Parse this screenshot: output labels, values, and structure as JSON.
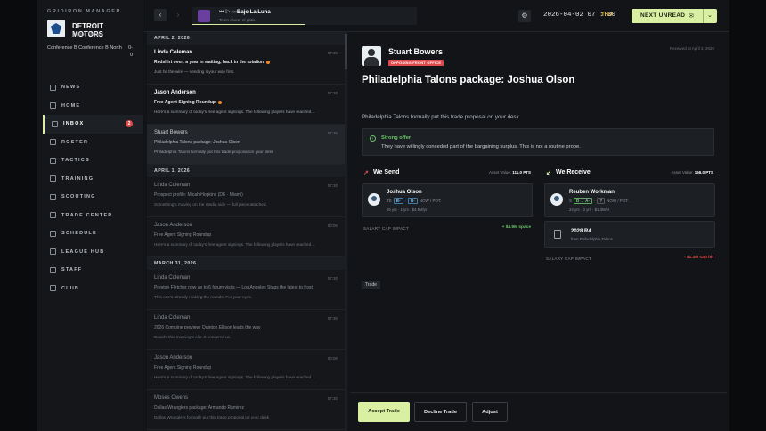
{
  "sidebar": {
    "brand": "GRIDIRON MANAGER",
    "team_name": "DETROIT MOTORS",
    "team_sub": "Detroit Motors",
    "conference": "Conference B Conference B North",
    "record_a": "0-",
    "record_b": "0",
    "items": [
      {
        "label": "NEWS"
      },
      {
        "label": "HOME"
      },
      {
        "label": "INBOX",
        "badge": "2"
      },
      {
        "label": "ROSTER"
      },
      {
        "label": "TACTICS"
      },
      {
        "label": "TRAINING"
      },
      {
        "label": "SCOUTING"
      },
      {
        "label": "TRADE CENTER"
      },
      {
        "label": "SCHEDULE"
      },
      {
        "label": "LEAGUE HUB"
      },
      {
        "label": "STAFF"
      },
      {
        "label": "CLUB"
      }
    ]
  },
  "topbar": {
    "back": "‹",
    "forward": "›",
    "song": "Bajo La Luna",
    "artist": "Te en crucer el patio",
    "controls": "⏮ ▷ ⏭",
    "gear": "⚙",
    "datetime": "2026-04-02 07 : 30",
    "day": "THU",
    "next_unread": "NEXT UNREAD",
    "mail_icon": "✉",
    "chevron": "⌄"
  },
  "inbox": {
    "days": [
      {
        "label": "APRIL 2, 2026",
        "messages": [
          {
            "from": "Linda Coleman",
            "time": "07:30",
            "subject": "Redshirt over: a year in waiting, back in the rotation",
            "preview": "Just hit the wire — sending it your way first.",
            "unread": true
          },
          {
            "from": "Jason Anderson",
            "time": "07:30",
            "subject": "Free Agent Signing Roundup",
            "preview": "Here's a summary of today's free agent signings. The following players have reached...",
            "unread": true
          },
          {
            "from": "Stuart Bowers",
            "time": "07:30",
            "subject": "Philadelphia Talons package: Joshua Olson",
            "preview": "Philadelphia Talons formally put this trade proposal on your desk",
            "selected": true
          }
        ]
      },
      {
        "label": "APRIL 1, 2026",
        "messages": [
          {
            "from": "Linda Coleman",
            "time": "07:30",
            "subject": "Prospect profile: Micah Hopkins (DE · Miami)",
            "preview": "Something's moving on the media side — full piece attached."
          },
          {
            "from": "Jason Anderson",
            "time": "00:00",
            "subject": "Free Agent Signing Roundup",
            "preview": "Here's a summary of today's free agent signings. The following players have reached..."
          }
        ]
      },
      {
        "label": "MARCH 31, 2026",
        "messages": [
          {
            "from": "Linda Coleman",
            "time": "07:30",
            "subject": "Preston Fletcher now up to 6 forum visits — Los Angeles Stags the latest to host",
            "preview": "This one's already making the rounds. For your eyes."
          },
          {
            "from": "Linda Coleman",
            "time": "07:30",
            "subject": "2026 Combine preview: Quinton Ellison leads the way",
            "preview": "Coach, this morning's clip. It concerns us."
          },
          {
            "from": "Jason Anderson",
            "time": "00:00",
            "subject": "Free Agent Signing Roundup",
            "preview": "Here's a summary of today's free agent signings. The following players have reached..."
          },
          {
            "from": "Moses Owens",
            "time": "07:30",
            "subject": "Dallas Wranglers package: Armando Ramirez",
            "preview": "Dallas Wranglers formally put this trade proposal on your desk"
          }
        ]
      }
    ]
  },
  "detail": {
    "sender": "Stuart Bowers",
    "office_badge": "OPPOSING FRONT OFFICE",
    "received": "Received at April 2, 2026",
    "headline": "Philadelphia Talons package: Joshua Olson",
    "body": "Philadelphia Talons formally put this trade proposal on your desk",
    "callout_title": "Strong offer",
    "callout_text": "They have willingly conceded part of the bargaining surplus. This is not a routine probe.",
    "send": {
      "title": "We Send",
      "asset_label": "Asset Value:",
      "asset_value": "111.0 PTS",
      "player_name": "Joshua Olson",
      "pos": "TE",
      "grade1": "B-",
      "grade2": "B-",
      "grade_note": "NOW / POT.",
      "meta": "26 yrs · 1 yrs · $4.9M/yr",
      "cap_label": "SALARY CAP IMPACT",
      "cap_value": "+ $4.9M space"
    },
    "receive": {
      "title": "We Receive",
      "asset_label": "Asset Value:",
      "asset_value": "156.0 PTS",
      "player_name": "Reuben Workman",
      "pos": "S",
      "grade1": "D → A-",
      "grade2": "?",
      "grade_note": "NOW / POT.",
      "meta": "24 yrs · 3 yrs · $1.3M/yr",
      "pick_name": "2028 R4",
      "pick_sub": "from Philadelphia Talons",
      "cap_label": "SALARY CAP IMPACT",
      "cap_value": "- $1.3M cap hit"
    },
    "tag": "Trade"
  },
  "actions": {
    "accept": "Accept Trade",
    "decline": "Decline Trade",
    "adjust": "Adjust"
  }
}
